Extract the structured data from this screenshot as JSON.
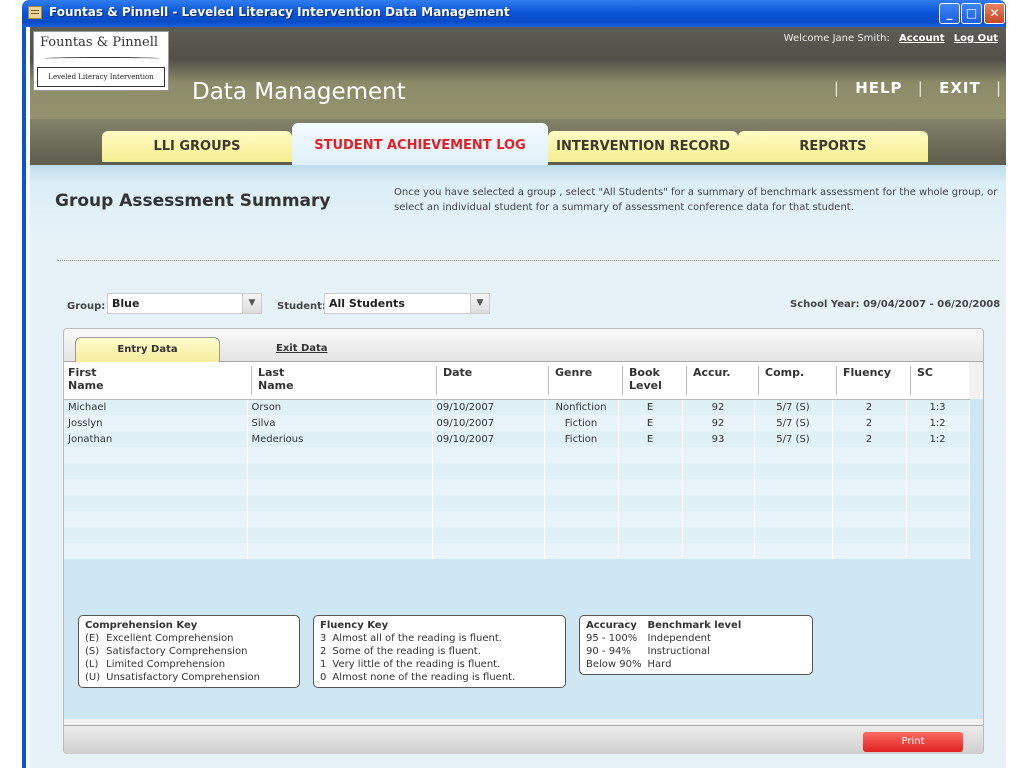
{
  "window": {
    "title": "Fountas & Pinnell - Leveled Literacy Intervention Data Management"
  },
  "header": {
    "logo_line1": "Fountas & Pinnell",
    "logo_line2": "Leveled Literacy Intervention",
    "app_title": "Data Management",
    "welcome": "Welcome Jane Smith:",
    "account_link": "Account",
    "logout_link": "Log Out",
    "help": "HELP",
    "exit": "EXIT"
  },
  "tabs": [
    {
      "label": "LLI GROUPS",
      "active": false
    },
    {
      "label": "STUDENT ACHIEVEMENT LOG",
      "active": true
    },
    {
      "label": "INTERVENTION RECORD",
      "active": false
    },
    {
      "label": "REPORTS",
      "active": false
    }
  ],
  "page": {
    "title": "Group Assessment Summary",
    "instructions": "Once you have selected a group , select \"All Students\" for a summary of benchmark assessment for the whole group, or select an individual student for a summary of assessment conference data for that student."
  },
  "filters": {
    "group_label": "Group:",
    "group_value": "Blue",
    "student_label": "Student:",
    "student_value": "All Students",
    "school_year": "School Year: 09/04/2007 - 06/20/2008"
  },
  "subtabs": {
    "entry": "Entry Data",
    "exit": "Exit Data"
  },
  "table": {
    "headers": [
      "First\nName",
      "Last\nName",
      "Date",
      "Genre",
      "Book\nLevel",
      "Accur.",
      "Comp.",
      "Fluency",
      "SC"
    ],
    "header_lines": [
      [
        "First",
        "Name"
      ],
      [
        "Last",
        "Name"
      ],
      [
        "Date",
        ""
      ],
      [
        "Genre",
        ""
      ],
      [
        "Book",
        "Level"
      ],
      [
        "Accur.",
        ""
      ],
      [
        "Comp.",
        ""
      ],
      [
        "Fluency",
        ""
      ],
      [
        "SC",
        ""
      ]
    ],
    "rows": [
      [
        "Michael",
        "Orson",
        "09/10/2007",
        "Nonfiction",
        "E",
        "92",
        "5/7 (S)",
        "2",
        "1:3"
      ],
      [
        "Josslyn",
        "Silva",
        "09/10/2007",
        "Fiction",
        "E",
        "92",
        "5/7 (S)",
        "2",
        "1:2"
      ],
      [
        "Jonathan",
        "Mederious",
        "09/10/2007",
        "Fiction",
        "E",
        "93",
        "5/7 (S)",
        "2",
        "1:2"
      ]
    ]
  },
  "keys": {
    "comprehension": {
      "title": "Comprehension Key",
      "items": [
        [
          "(E)",
          "Excellent Comprehension"
        ],
        [
          "(S)",
          "Satisfactory Comprehension"
        ],
        [
          "(L)",
          "Limited Comprehension"
        ],
        [
          "(U)",
          "Unsatisfactory Comprehension"
        ]
      ]
    },
    "fluency": {
      "title": "Fluency Key",
      "items": [
        [
          "3",
          "Almost all of the reading is fluent."
        ],
        [
          "2",
          "Some of the reading is fluent."
        ],
        [
          "1",
          "Very little of the reading is fluent."
        ],
        [
          "0",
          "Almost none of the reading is fluent."
        ]
      ]
    },
    "accuracy": {
      "title": "Accuracy",
      "title2": "Benchmark level",
      "items": [
        [
          "95 - 100%",
          "Independent"
        ],
        [
          "90 - 94%",
          "Instructional"
        ],
        [
          "Below 90%",
          "Hard"
        ]
      ]
    }
  },
  "footer": {
    "print": "Print"
  },
  "colors": {
    "active_tab_text": "#e21f26",
    "tab_bg": "#f6ee8f",
    "print_button": "#e8302c",
    "xp_titlebar": "#0b56d8"
  }
}
